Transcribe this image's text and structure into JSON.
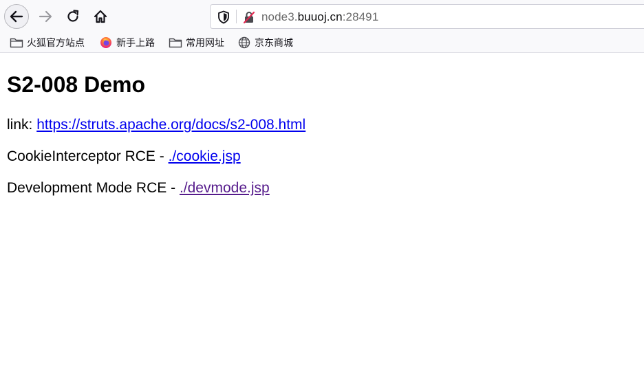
{
  "browser": {
    "url_host_prefix": "node3.",
    "url_domain": "buuoj.cn",
    "url_port": ":28491"
  },
  "bookmarks": [
    {
      "label": "火狐官方站点",
      "icon": "folder-icon"
    },
    {
      "label": "新手上路",
      "icon": "firefox-icon"
    },
    {
      "label": "常用网址",
      "icon": "folder-icon"
    },
    {
      "label": "京东商城",
      "icon": "globe-icon"
    }
  ],
  "page": {
    "title": "S2-008 Demo",
    "link_prefix": "link: ",
    "link_url": "https://struts.apache.org/docs/s2-008.html",
    "cookie_prefix": "CookieInterceptor RCE - ",
    "cookie_link": "./cookie.jsp",
    "devmode_prefix": "Development Mode RCE - ",
    "devmode_link": "./devmode.jsp"
  },
  "colors": {
    "link": "#0000ee",
    "visited_link": "#551a8b"
  }
}
